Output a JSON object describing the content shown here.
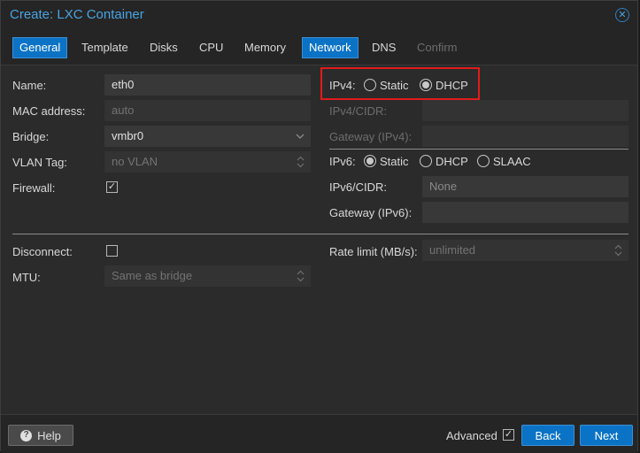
{
  "window": {
    "title": "Create: LXC Container"
  },
  "tabs": [
    {
      "label": "General",
      "state": "active"
    },
    {
      "label": "Template",
      "state": "normal"
    },
    {
      "label": "Disks",
      "state": "normal"
    },
    {
      "label": "CPU",
      "state": "normal"
    },
    {
      "label": "Memory",
      "state": "normal"
    },
    {
      "label": "Network",
      "state": "active"
    },
    {
      "label": "DNS",
      "state": "normal"
    },
    {
      "label": "Confirm",
      "state": "disabled"
    }
  ],
  "left": {
    "name_label": "Name:",
    "name_value": "eth0",
    "mac_label": "MAC address:",
    "mac_placeholder": "auto",
    "bridge_label": "Bridge:",
    "bridge_value": "vmbr0",
    "vlan_label": "VLAN Tag:",
    "vlan_placeholder": "no VLAN",
    "firewall_label": "Firewall:",
    "firewall_checked": true
  },
  "right": {
    "ipv4_label": "IPv4:",
    "ipv4_options": [
      "Static",
      "DHCP"
    ],
    "ipv4_selected": "DHCP",
    "ipv4_cidr_label": "IPv4/CIDR:",
    "gateway4_label": "Gateway (IPv4):",
    "ipv6_label": "IPv6:",
    "ipv6_options": [
      "Static",
      "DHCP",
      "SLAAC"
    ],
    "ipv6_selected": "Static",
    "ipv6_cidr_label": "IPv6/CIDR:",
    "ipv6_cidr_placeholder": "None",
    "gateway6_label": "Gateway (IPv6):"
  },
  "bottom": {
    "disconnect_label": "Disconnect:",
    "disconnect_checked": false,
    "mtu_label": "MTU:",
    "mtu_placeholder": "Same as bridge",
    "rate_label": "Rate limit (MB/s):",
    "rate_placeholder": "unlimited"
  },
  "footer": {
    "help_label": "Help",
    "advanced_label": "Advanced",
    "advanced_checked": true,
    "back_label": "Back",
    "next_label": "Next"
  },
  "colors": {
    "accent": "#0b73c5",
    "title": "#4aa3df",
    "highlight": "#e01b1b",
    "background": "#2b2b2b"
  }
}
